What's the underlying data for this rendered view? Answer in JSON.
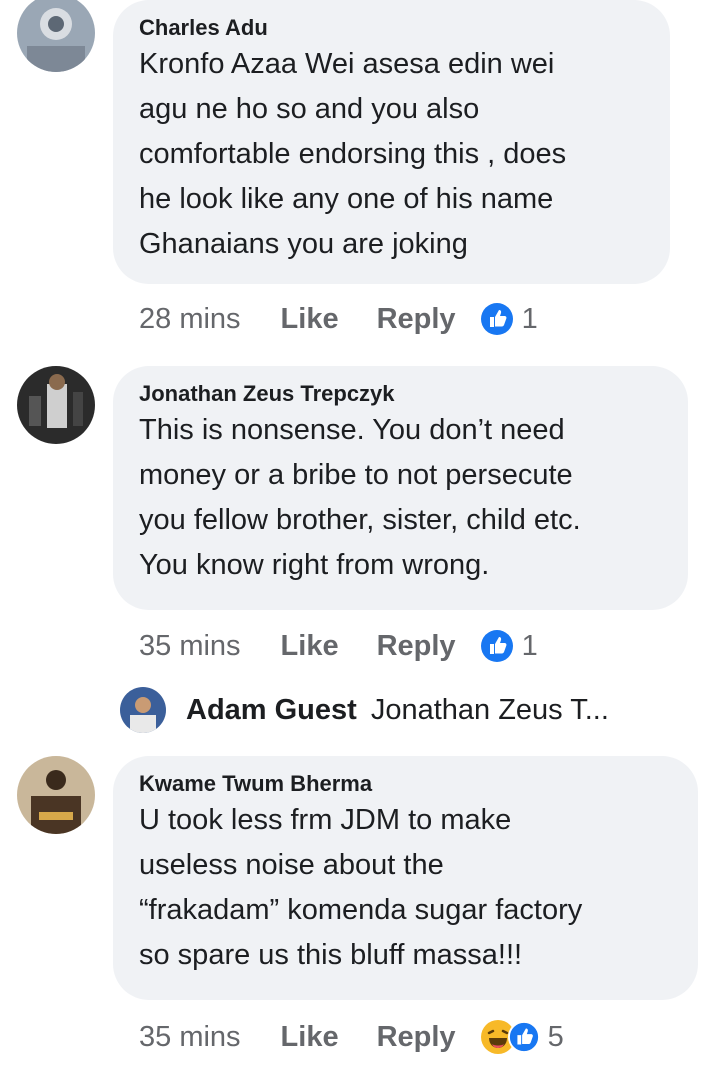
{
  "comments": [
    {
      "author": "Charles Adu",
      "text": "Kronfo Azaa Wei asesa edin wei\nagu ne ho so and you also\ncomfortable endorsing this , does\nhe look like any one of his name\nGhanaians you are joking",
      "time": "28 mins",
      "like": "Like",
      "reply": "Reply",
      "reaction_count": "1",
      "reactions": [
        "like-icon"
      ]
    },
    {
      "author": "Jonathan Zeus Trepczyk",
      "text": "This is nonsense. You don’t need\nmoney or a bribe to not persecute\nyou fellow brother, sister, child etc.\nYou know right from wrong.",
      "time": "35 mins",
      "like": "Like",
      "reply": "Reply",
      "reaction_count": "1",
      "reactions": [
        "like-icon"
      ]
    },
    {
      "author": "Kwame Twum Bherma",
      "text": "U took less  frm JDM to make\nuseless noise about the\n“frakadam” komenda sugar factory\nso spare us this bluff massa!!!",
      "time": "35 mins",
      "like": "Like",
      "reply": "Reply",
      "reaction_count": "5",
      "reactions": [
        "haha-icon",
        "like-icon"
      ]
    }
  ],
  "reply_preview": {
    "author": "Adam Guest",
    "text": "Jonathan Zeus T..."
  },
  "colors": {
    "bubble": "#f0f2f5",
    "meta_text": "#65676b",
    "like_blue": "#1877f2",
    "haha_yellow": "#f7b928"
  }
}
